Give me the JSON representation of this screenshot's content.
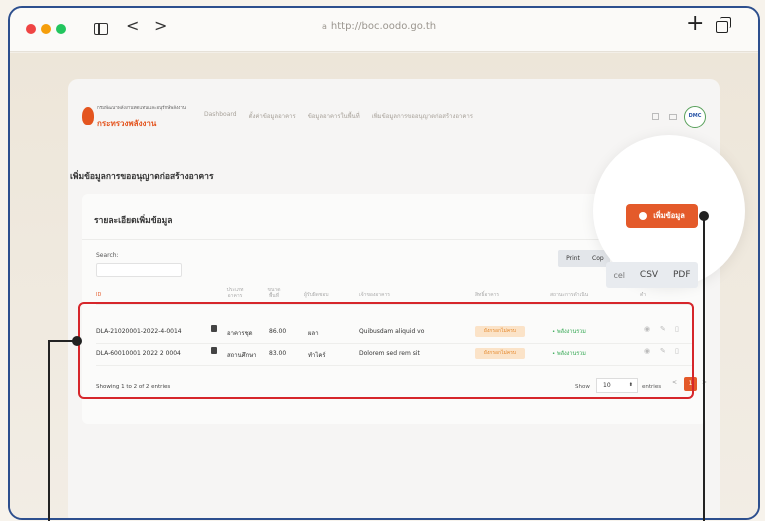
{
  "browser": {
    "url": "http://boc.oodo.go.th"
  },
  "header": {
    "logo_line1": "กรมพัฒนาพลังงานทดแทนและอนุรักษ์พลังงาน",
    "logo_line2": "กระทรวงพลังงาน",
    "nav": [
      "Dashboard",
      "ตั้งค่าข้อมูลอาคาร",
      "ข้อมูลอาคารในพื้นที่",
      "เพิ่มข้อมูลการขออนุญาตก่อสร้างอาคาร"
    ],
    "avatar_text": "DMC"
  },
  "page_title": "เพิ่มข้อมูลการขออนุญาตก่อสร้างอาคาร",
  "card": {
    "title": "รายละเอียดเพิ่มข้อมูล",
    "add_button": "เพิ่มข้อมูล",
    "search_label": "Search:",
    "export": {
      "print": "Print",
      "copy": "Cop",
      "excel": "cel",
      "csv": "CSV",
      "pdf": "PDF"
    },
    "columns": [
      "ID",
      "ประเภท อาคาร",
      "ขนาด พื้นที่",
      "ผู้รับผิดชอบ",
      "เจ้าของอาคาร",
      "สิทธิ์อาคาร",
      "สถานะการดำเนิน",
      "ดำ"
    ],
    "rows": [
      {
        "id": "DLA-21020001-2022-4-0014",
        "type": "อาคารชุด",
        "area": "86.00",
        "owner": "ผลา",
        "building_owner": "Quibusdam aliquid vo",
        "right": "ยังกรอกไม่ครบ",
        "status": "• พลังงานรวม"
      },
      {
        "id": "DLA-60010001 2022 2 0004",
        "type": "สถานศึกษา",
        "area": "83.00",
        "owner": "ทำไคร์",
        "building_owner": "Dolorem sed rem sit",
        "right": "ยังกรอกไม่ครบ",
        "status": "• พลังงานรวม"
      }
    ],
    "info": "Showing 1 to 2 of 2 entries",
    "show_label": "Show",
    "show_value": "10",
    "entries_label": "entries",
    "current_page": "1"
  },
  "colors": {
    "accent": "#e45a2a",
    "highlight": "#d6262b",
    "window_border": "#2d4f8e"
  }
}
